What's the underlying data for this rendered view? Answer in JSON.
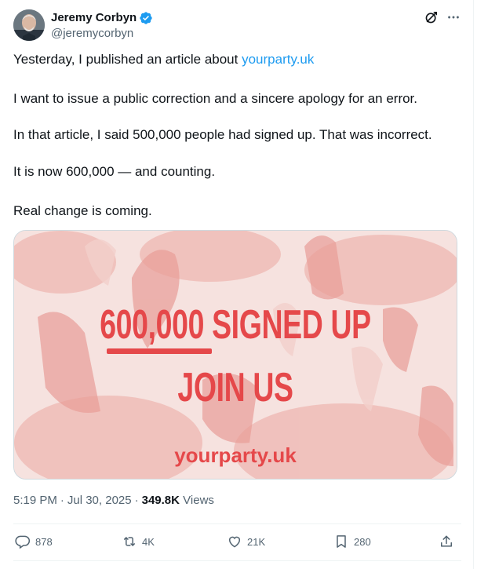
{
  "author": {
    "name": "Jeremy Corbyn",
    "handle": "@jeremycorbyn",
    "verified_icon": "verified-badge-icon",
    "verified_color": "#1d9bf0"
  },
  "header_icons": {
    "grok": "grok-icon",
    "more": "more-icon"
  },
  "tweet": {
    "line1_prefix": "Yesterday, I published an article about ",
    "line1_link": "yourparty.uk",
    "line2": "I want to issue a public correction and a sincere apology for an error.",
    "line3": "In that article, I said 500,000 people had signed up. That was incorrect.",
    "line4": "It is now 600,000 — and counting.",
    "line5": "Real change is coming."
  },
  "media": {
    "headline1": "600,000 SIGNED UP",
    "headline2": "JOIN US",
    "url": "yourparty.uk",
    "accent": "#e5484a",
    "background_tint": "#f6e2df"
  },
  "meta": {
    "time": "5:19 PM",
    "date": "Jul 30, 2025",
    "views_count": "349.8K",
    "views_label": "Views"
  },
  "actions": {
    "replies": "878",
    "reposts": "4K",
    "likes": "21K",
    "bookmarks": "280"
  },
  "colors": {
    "text": "#0f1419",
    "secondary": "#536471",
    "link": "#1d9bf0",
    "divider": "#eff3f4"
  }
}
